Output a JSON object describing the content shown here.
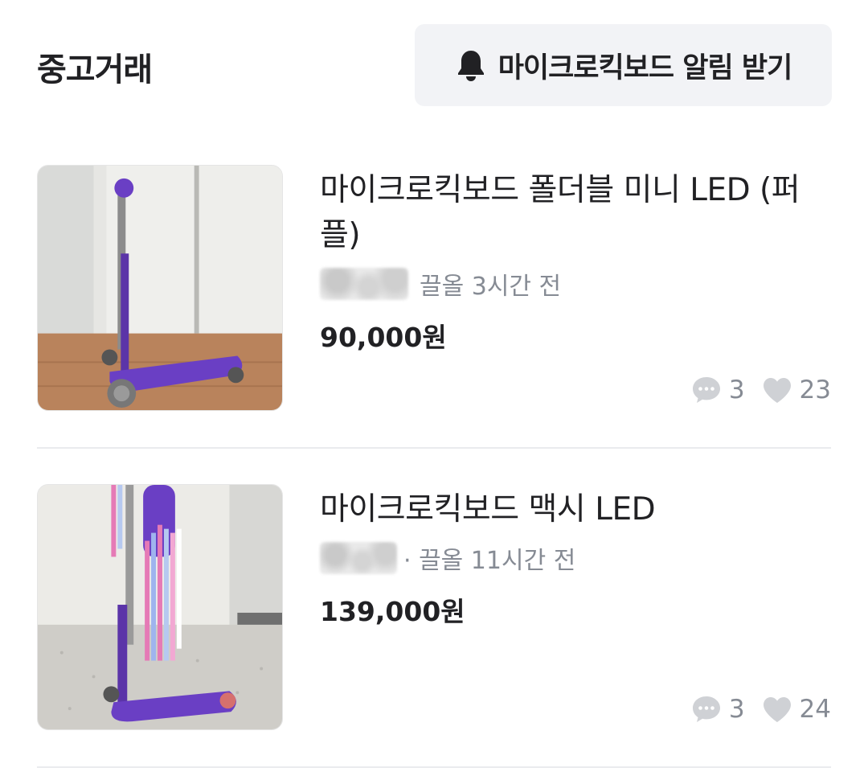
{
  "header": {
    "title": "중고거래",
    "alert_button_label": "마이크로킥보드 알림 받기",
    "alert_icon": "bell-icon"
  },
  "items": [
    {
      "title": "마이크로킥보드 폴더블 미니 LED (퍼플)",
      "meta": "끌올 3시간 전",
      "price": "90,000원",
      "comments": "3",
      "likes": "23",
      "thumbnail": "purple mini micro kick scooter"
    },
    {
      "title": "마이크로킥보드 맥시 LED",
      "meta": "· 끌올 11시간 전",
      "price": "139,000원",
      "comments": "3",
      "likes": "24",
      "thumbnail": "purple maxi micro kick scooter with tassels"
    }
  ],
  "colors": {
    "text_primary": "#212124",
    "text_secondary": "#868b94",
    "button_bg": "#f2f3f6",
    "scooter_purple": "#6a3fc4"
  }
}
